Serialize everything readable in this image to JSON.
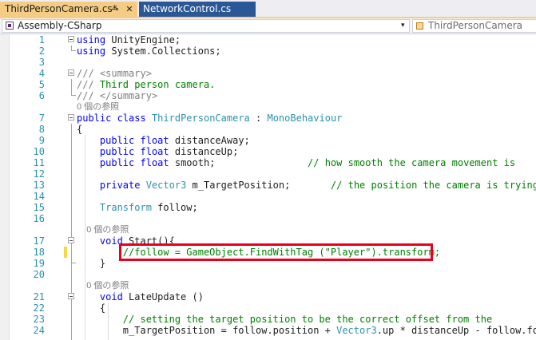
{
  "tabs": [
    {
      "label": "ThirdPersonCamera.cs*",
      "active": true,
      "pin_glyph": "⊸",
      "close_glyph": "✕"
    },
    {
      "label": "NetworkControl.cs",
      "active": false
    }
  ],
  "nav": {
    "project": "Assembly-CSharp",
    "class": "ThirdPersonCamera",
    "dropdown_glyph": "▾"
  },
  "colors": {
    "active_tab": "#f5cc84",
    "inactive_tab": "#2b5797",
    "keyword": "#0000ff",
    "type": "#2b91af",
    "comment": "#008000",
    "string": "#a31515",
    "highlight_box": "#e8001c",
    "change_marker": "#f4d742"
  },
  "code": {
    "lines": [
      {
        "num": "1",
        "parts": [
          {
            "c": "kw",
            "t": "using"
          },
          {
            "c": "",
            "t": " UnityEngine;"
          }
        ]
      },
      {
        "num": "2",
        "parts": [
          {
            "c": "kw",
            "t": "using"
          },
          {
            "c": "",
            "t": " System.Collections;"
          }
        ]
      },
      {
        "num": "3",
        "parts": []
      },
      {
        "num": "4",
        "parts": [
          {
            "c": "xd",
            "t": "///"
          },
          {
            "c": "cm",
            "t": " "
          },
          {
            "c": "xd",
            "t": "<summary>"
          }
        ]
      },
      {
        "num": "5",
        "parts": [
          {
            "c": "xd",
            "t": "///"
          },
          {
            "c": "cm",
            "t": " Third person camera."
          }
        ]
      },
      {
        "num": "6",
        "parts": [
          {
            "c": "xd",
            "t": "///"
          },
          {
            "c": "cm",
            "t": " "
          },
          {
            "c": "xd",
            "t": "</summary>"
          }
        ]
      },
      {
        "lens": "0 個の参照"
      },
      {
        "num": "7",
        "parts": [
          {
            "c": "kw",
            "t": "public"
          },
          {
            "c": "",
            "t": " "
          },
          {
            "c": "kw",
            "t": "class"
          },
          {
            "c": "",
            "t": " "
          },
          {
            "c": "ty",
            "t": "ThirdPersonCamera"
          },
          {
            "c": "",
            "t": " : "
          },
          {
            "c": "ty",
            "t": "MonoBehaviour"
          }
        ]
      },
      {
        "num": "8",
        "parts": [
          {
            "c": "",
            "t": "{"
          }
        ]
      },
      {
        "num": "9",
        "parts": [
          {
            "c": "",
            "t": "    "
          },
          {
            "c": "kw",
            "t": "public"
          },
          {
            "c": "",
            "t": " "
          },
          {
            "c": "kw",
            "t": "float"
          },
          {
            "c": "",
            "t": " distanceAway;"
          }
        ]
      },
      {
        "num": "10",
        "parts": [
          {
            "c": "",
            "t": "    "
          },
          {
            "c": "kw",
            "t": "public"
          },
          {
            "c": "",
            "t": " "
          },
          {
            "c": "kw",
            "t": "float"
          },
          {
            "c": "",
            "t": " distanceUp;"
          }
        ]
      },
      {
        "num": "11",
        "parts": [
          {
            "c": "",
            "t": "    "
          },
          {
            "c": "kw",
            "t": "public"
          },
          {
            "c": "",
            "t": " "
          },
          {
            "c": "kw",
            "t": "float"
          },
          {
            "c": "",
            "t": " smooth;                "
          },
          {
            "c": "cm",
            "t": "// how smooth the camera movement is"
          }
        ]
      },
      {
        "num": "12",
        "parts": []
      },
      {
        "num": "13",
        "parts": [
          {
            "c": "",
            "t": "    "
          },
          {
            "c": "kw",
            "t": "private"
          },
          {
            "c": "",
            "t": " "
          },
          {
            "c": "ty",
            "t": "Vector3"
          },
          {
            "c": "",
            "t": " m_TargetPosition;       "
          },
          {
            "c": "cm",
            "t": "// the position the camera is trying to be in"
          }
        ]
      },
      {
        "num": "14",
        "parts": []
      },
      {
        "num": "15",
        "parts": [
          {
            "c": "",
            "t": "    "
          },
          {
            "c": "ty",
            "t": "Transform"
          },
          {
            "c": "",
            "t": " follow;"
          }
        ]
      },
      {
        "num": "16",
        "parts": []
      },
      {
        "lens": "    0 個の参照"
      },
      {
        "num": "17",
        "parts": [
          {
            "c": "",
            "t": "    "
          },
          {
            "c": "kw",
            "t": "void"
          },
          {
            "c": "",
            "t": " Start(){"
          }
        ]
      },
      {
        "num": "18",
        "parts": [
          {
            "c": "",
            "t": "        "
          },
          {
            "c": "cm",
            "t": "//follow = GameObject.FindWithTag (\"Player\").transform;"
          }
        ]
      },
      {
        "num": "19",
        "parts": [
          {
            "c": "",
            "t": "    }"
          }
        ]
      },
      {
        "num": "20",
        "parts": []
      },
      {
        "lens": "    0 個の参照"
      },
      {
        "num": "21",
        "parts": [
          {
            "c": "",
            "t": "    "
          },
          {
            "c": "kw",
            "t": "void"
          },
          {
            "c": "",
            "t": " LateUpdate ()"
          }
        ]
      },
      {
        "num": "22",
        "parts": [
          {
            "c": "",
            "t": "    {"
          }
        ]
      },
      {
        "num": "23",
        "parts": [
          {
            "c": "",
            "t": "        "
          },
          {
            "c": "cm",
            "t": "// setting the target position to be the correct offset from the"
          }
        ]
      },
      {
        "num": "24",
        "parts": [
          {
            "c": "",
            "t": "        m_TargetPosition = follow.position + "
          },
          {
            "c": "ty",
            "t": "Vector3"
          },
          {
            "c": "",
            "t": ".up * distanceUp - follow.forward * distanceAway;"
          }
        ]
      }
    ]
  }
}
